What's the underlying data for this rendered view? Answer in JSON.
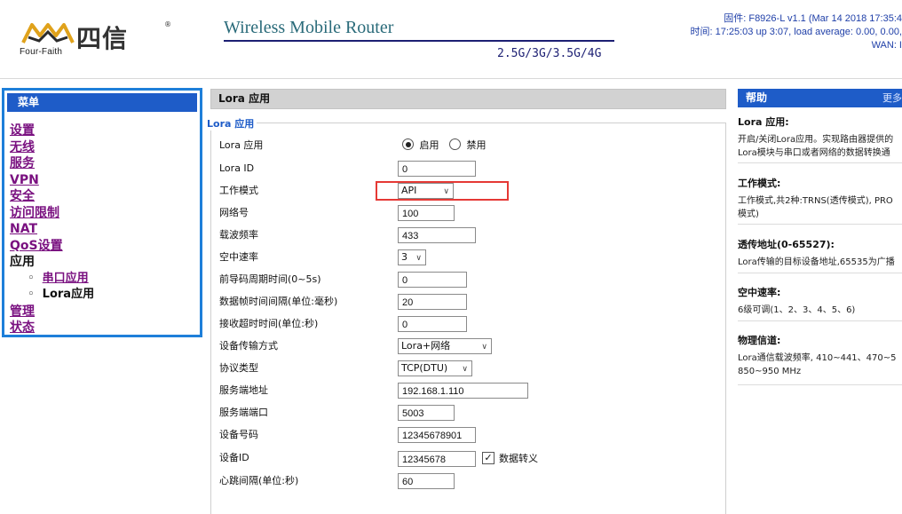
{
  "header": {
    "logo_brand": "Four-Faith",
    "logo_cn": "四信",
    "logo_reg": "®",
    "title": "Wireless Mobile Router",
    "bands": "2.5G/3G/3.5G/4G",
    "firmware": "固件: F8926-L v1.1 (Mar 14 2018 17:35:4",
    "time": "时间: 17:25:03 up 3:07, load average: 0.00, 0.00,",
    "wan": "WAN: I"
  },
  "menu": {
    "title": "菜单",
    "items": [
      "设置",
      "无线",
      "服务",
      "VPN",
      "安全",
      "访问限制",
      "NAT",
      "QoS设置"
    ],
    "current": "应用",
    "sub": [
      "串口应用",
      "Lora应用"
    ],
    "after": [
      "管理",
      "状态"
    ]
  },
  "main": {
    "title": "Lora 应用",
    "legend": "Lora 应用",
    "fields": {
      "lora_app": {
        "label": "Lora 应用",
        "opt_on": "启用",
        "opt_off": "禁用"
      },
      "lora_id": {
        "label": "Lora ID",
        "value": "0"
      },
      "work_mode": {
        "label": "工作模式",
        "value": "API"
      },
      "net_id": {
        "label": "网络号",
        "value": "100"
      },
      "carrier_freq": {
        "label": "载波频率",
        "value": "433"
      },
      "air_rate": {
        "label": "空中速率",
        "value": "3"
      },
      "preamble": {
        "label": "前导码周期时间(0~5s)",
        "value": "0"
      },
      "frame_interval": {
        "label": "数据帧时间间隔(单位:毫秒)",
        "value": "20"
      },
      "recv_timeout": {
        "label": "接收超时时间(单位:秒)",
        "value": "0"
      },
      "transfer_mode": {
        "label": "设备传输方式",
        "value": "Lora+网络"
      },
      "protocol": {
        "label": "协议类型",
        "value": "TCP(DTU)"
      },
      "server_addr": {
        "label": "服务端地址",
        "value": "192.168.1.110"
      },
      "server_port": {
        "label": "服务端端口",
        "value": "5003"
      },
      "device_num": {
        "label": "设备号码",
        "value": "12345678901"
      },
      "device_id": {
        "label": "设备ID",
        "value": "12345678",
        "escape_label": "数据转义"
      },
      "heartbeat": {
        "label": "心跳间隔(单位:秒)",
        "value": "60"
      }
    }
  },
  "help": {
    "title": "帮助",
    "more": "更多",
    "sections": [
      {
        "title": "Lora 应用:",
        "lines": [
          "开启/关闭Lora应用。实现路由器提供的",
          "Lora模块与串口或者网络的数据转换通"
        ]
      },
      {
        "title": "工作模式:",
        "lines": [
          "工作模式,共2种:TRNS(透传模式), PRO",
          "模式)"
        ]
      },
      {
        "title": "透传地址(0-65527):",
        "lines": [
          "Lora传输的目标设备地址,65535为广播"
        ]
      },
      {
        "title": "空中速率:",
        "lines": [
          "6级可调(1、2、3、4、5、6)"
        ]
      },
      {
        "title": "物理信道:",
        "lines": [
          "Lora通信载波频率, 410~441、470~5",
          "850~950 MHz"
        ]
      }
    ]
  },
  "colors": {
    "menu_blue": "#1e5cc8",
    "menu_border": "#1e7fd9",
    "link_purple": "#7a1180",
    "highlight_red": "#e53935",
    "title_teal": "#2a6b7a"
  }
}
